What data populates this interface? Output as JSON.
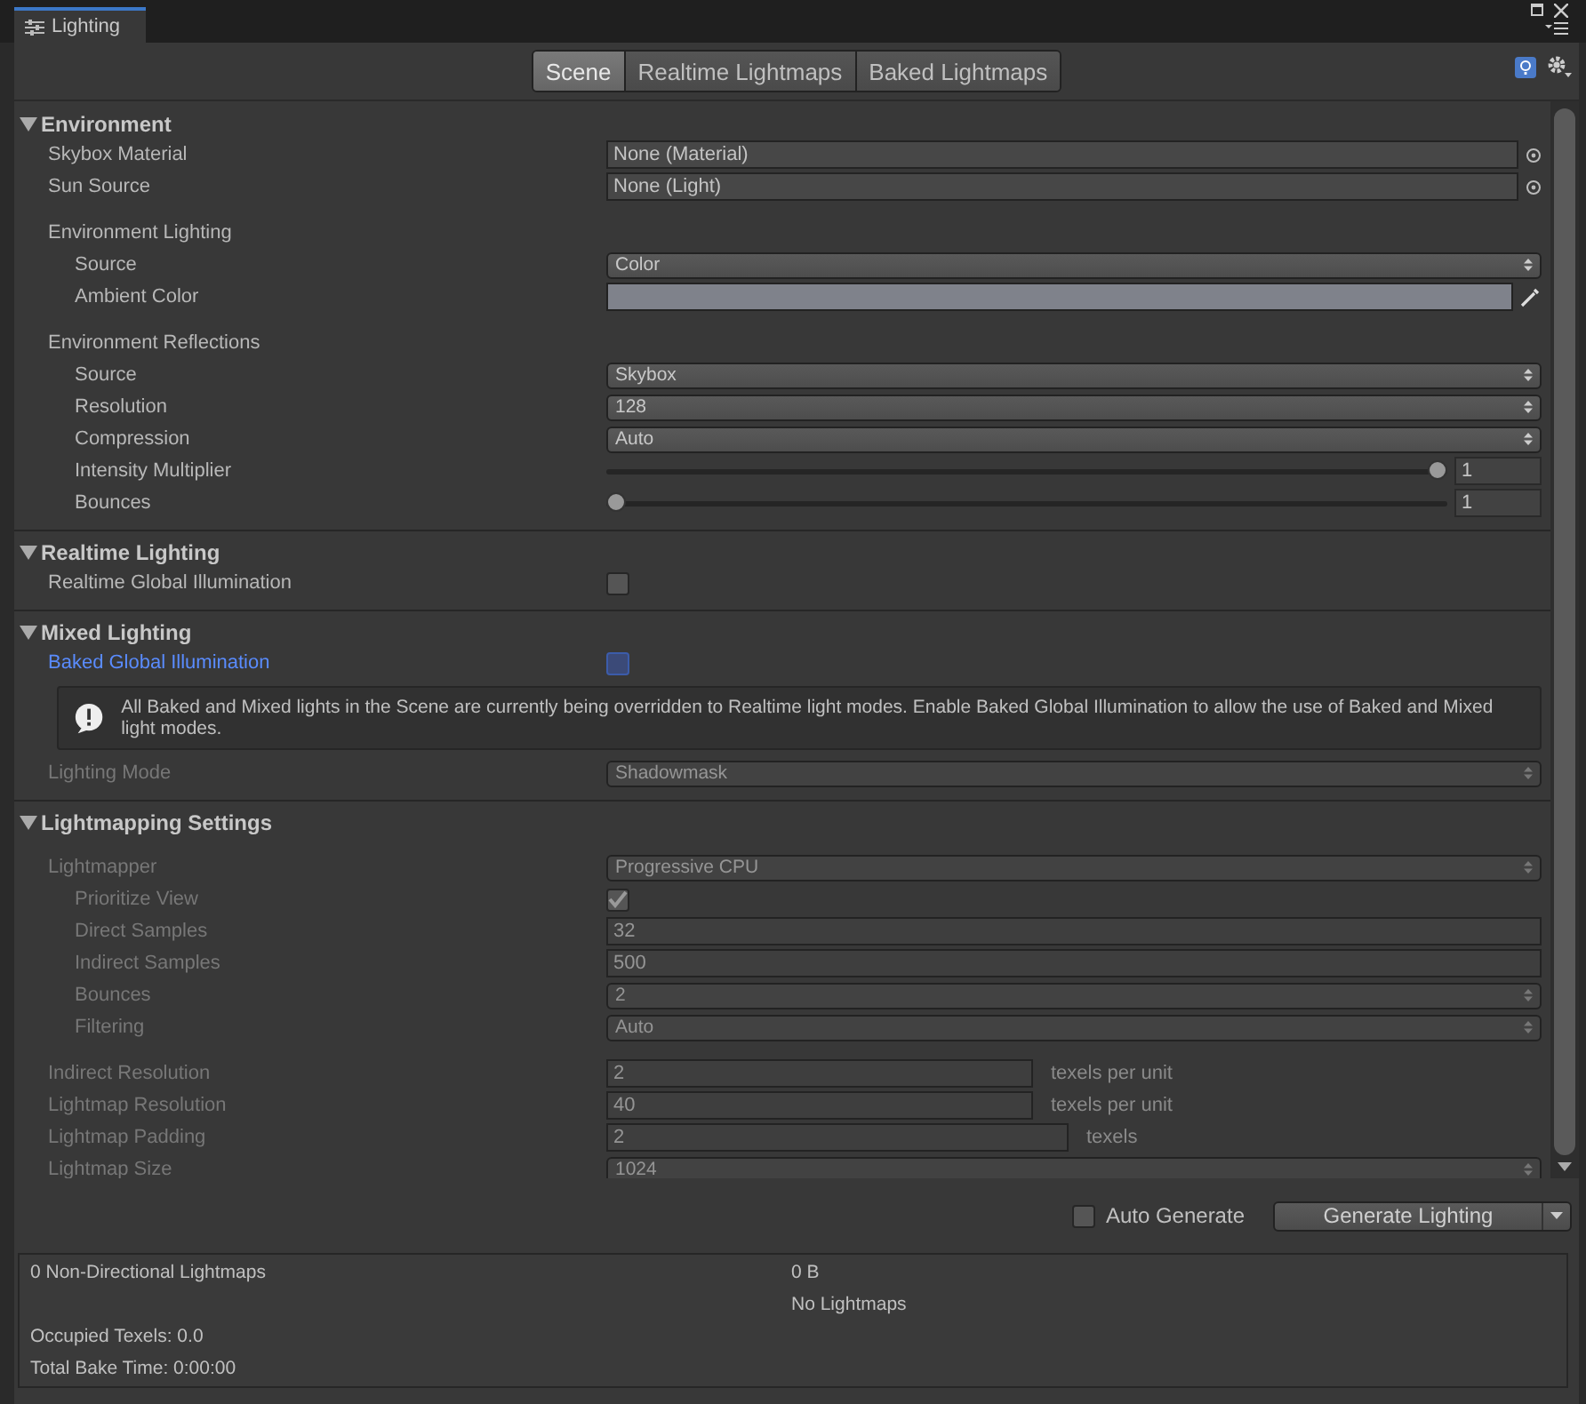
{
  "window": {
    "tab_title": "Lighting"
  },
  "mode_tabs": [
    {
      "label": "Scene",
      "selected": true
    },
    {
      "label": "Realtime Lightmaps",
      "selected": false
    },
    {
      "label": "Baked Lightmaps",
      "selected": false
    }
  ],
  "sections": [
    {
      "title": "Environment",
      "expanded": true,
      "rows": [
        {
          "kind": "object",
          "label": "Skybox Material",
          "value": "None (Material)"
        },
        {
          "kind": "object",
          "label": "Sun Source",
          "value": "None (Light)"
        },
        {
          "kind": "group",
          "label": "Environment Lighting",
          "children": [
            {
              "kind": "dropdown",
              "label": "Source",
              "value": "Color"
            },
            {
              "kind": "color",
              "label": "Ambient Color",
              "color": "#7f828b"
            }
          ]
        },
        {
          "kind": "group",
          "label": "Environment Reflections",
          "children": [
            {
              "kind": "dropdown",
              "label": "Source",
              "value": "Skybox"
            },
            {
              "kind": "dropdown",
              "label": "Resolution",
              "value": "128"
            },
            {
              "kind": "dropdown",
              "label": "Compression",
              "value": "Auto"
            },
            {
              "kind": "slider",
              "label": "Intensity Multiplier",
              "level": 1,
              "value": "1"
            },
            {
              "kind": "slider",
              "label": "Bounces",
              "level": 0,
              "value": "1"
            }
          ]
        }
      ]
    },
    {
      "title": "Realtime Lighting",
      "expanded": true,
      "rows": [
        {
          "kind": "checkbox",
          "label": "Realtime Global Illumination",
          "checked": false
        }
      ]
    },
    {
      "title": "Mixed Lighting",
      "expanded": true,
      "rows": [
        {
          "kind": "checkbox",
          "label": "Baked Global Illumination",
          "checked": false,
          "focused": true
        },
        {
          "kind": "warning",
          "text": "All Baked and Mixed lights in the Scene are currently being overridden to Realtime light modes. Enable Baked Global Illumination to allow the use of Baked and Mixed light modes."
        },
        {
          "kind": "dropdown",
          "label": "Lighting Mode",
          "value": "Shadowmask",
          "disabled": true
        }
      ]
    },
    {
      "title": "Lightmapping Settings",
      "expanded": true,
      "rows": [
        {
          "kind": "group",
          "label": "Lightmapper",
          "value": "Progressive CPU",
          "disabled": true,
          "children": [
            {
              "kind": "checkbox",
              "label": "Prioritize View",
              "checked": true,
              "disabled": true
            },
            {
              "kind": "number",
              "label": "Direct Samples",
              "value": "32",
              "disabled": true
            },
            {
              "kind": "number",
              "label": "Indirect Samples",
              "value": "500",
              "disabled": true
            },
            {
              "kind": "dropdown",
              "label": "Bounces",
              "value": "2",
              "disabled": true
            },
            {
              "kind": "dropdown",
              "label": "Filtering",
              "value": "Auto",
              "disabled": true
            }
          ]
        },
        {
          "kind": "number",
          "label": "Indirect Resolution",
          "value": "2",
          "unit": "texels per unit",
          "disabled": true
        },
        {
          "kind": "number",
          "label": "Lightmap Resolution",
          "value": "40",
          "unit": "texels per unit",
          "disabled": true
        },
        {
          "kind": "number",
          "label": "Lightmap Padding",
          "value": "2",
          "unit": "texels",
          "disabled": true
        },
        {
          "kind": "dropdown",
          "label": "Lightmap Size",
          "value": "1024",
          "disabled": true
        }
      ]
    }
  ],
  "footer": {
    "auto_generate": {
      "label": "Auto Generate",
      "checked": false
    },
    "generate_button": "Generate Lighting"
  },
  "stats": [
    {
      "left": "0 Non-Directional Lightmaps",
      "right": "0 B"
    },
    {
      "right": "No Lightmaps"
    },
    {
      "left": "Occupied Texels: 0.0"
    },
    {
      "left": "Total Bake Time: 0:00:00"
    }
  ]
}
